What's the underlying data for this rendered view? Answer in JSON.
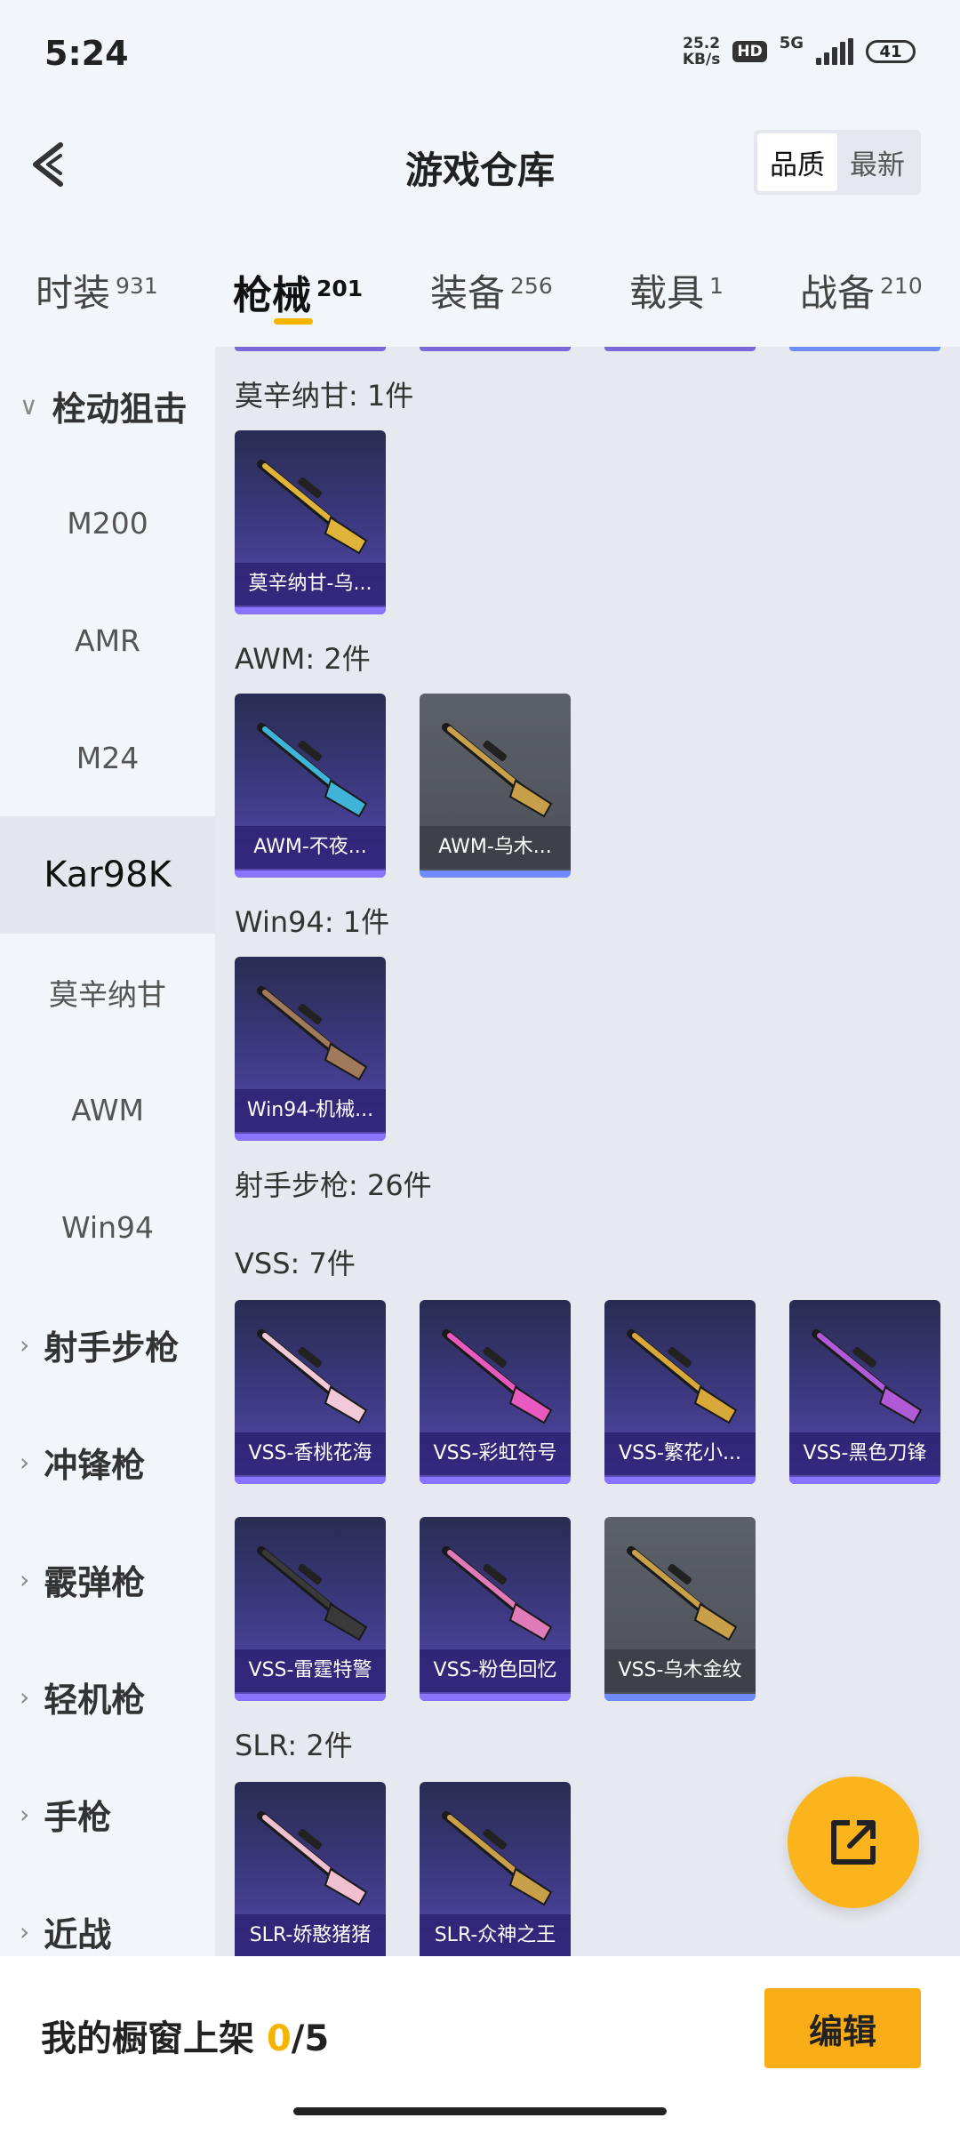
{
  "status_bar": {
    "time": "5:24",
    "net_speed_value": "25.2",
    "net_speed_unit": "KB/s",
    "hd_badge": "HD",
    "network": "5G",
    "battery": "41"
  },
  "header": {
    "title": "游戏仓库",
    "sort_options": [
      "品质",
      "最新"
    ],
    "active_sort": "品质"
  },
  "tabs": [
    {
      "label": "时装",
      "count": "931"
    },
    {
      "label": "枪械",
      "count": "201",
      "active": true
    },
    {
      "label": "装备",
      "count": "256"
    },
    {
      "label": "载具",
      "count": "1"
    },
    {
      "label": "战备",
      "count": "210"
    }
  ],
  "sidebar": {
    "items": [
      {
        "label": "栓动狙击",
        "type": "group",
        "expanded": true
      },
      {
        "label": "M200",
        "type": "sub"
      },
      {
        "label": "AMR",
        "type": "sub"
      },
      {
        "label": "M24",
        "type": "sub"
      },
      {
        "label": "Kar98K",
        "type": "sub",
        "selected": true
      },
      {
        "label": "莫辛纳甘",
        "type": "sub"
      },
      {
        "label": "AWM",
        "type": "sub"
      },
      {
        "label": "Win94",
        "type": "sub"
      },
      {
        "label": "射手步枪",
        "type": "group"
      },
      {
        "label": "冲锋枪",
        "type": "group"
      },
      {
        "label": "霰弹枪",
        "type": "group"
      },
      {
        "label": "轻机枪",
        "type": "group"
      },
      {
        "label": "手枪",
        "type": "group"
      },
      {
        "label": "近战",
        "type": "group"
      }
    ]
  },
  "sections": {
    "mosin": {
      "title": "莫辛纳甘: 1件",
      "items": [
        {
          "label": "莫辛纳甘-乌...",
          "style": "purple",
          "gun_color": "#e0b43a"
        }
      ]
    },
    "awm": {
      "title": "AWM: 2件",
      "items": [
        {
          "label": "AWM-不夜...",
          "style": "purple",
          "gun_color": "#3fb4d8"
        },
        {
          "label": "AWM-乌木...",
          "style": "gray",
          "gun_color": "#c9a04a"
        }
      ]
    },
    "win94": {
      "title": "Win94: 1件",
      "items": [
        {
          "label": "Win94-机械...",
          "style": "purple",
          "gun_color": "#a07a5a"
        }
      ]
    },
    "marksman": {
      "title": "射手步枪: 26件"
    },
    "vss": {
      "title": "VSS: 7件",
      "items": [
        {
          "label": "VSS-香桃花海",
          "style": "purple",
          "gun_color": "#f2c9d8"
        },
        {
          "label": "VSS-彩虹符号",
          "style": "purple",
          "gun_color": "#e85ac0"
        },
        {
          "label": "VSS-繁花小...",
          "style": "purple",
          "gun_color": "#d9a83a"
        },
        {
          "label": "VSS-黑色刀锋",
          "style": "purple",
          "gun_color": "#b05ad8"
        },
        {
          "label": "VSS-雷霆特警",
          "style": "purple",
          "gun_color": "#3a3a3a"
        },
        {
          "label": "VSS-粉色回忆",
          "style": "purple",
          "gun_color": "#e07ab8"
        },
        {
          "label": "VSS-乌木金纹",
          "style": "gray",
          "gun_color": "#c9a04a"
        }
      ]
    },
    "slr": {
      "title": "SLR: 2件",
      "items": [
        {
          "label": "SLR-娇憨猪猪",
          "style": "purple",
          "gun_color": "#f0c0d0"
        },
        {
          "label": "SLR-众神之王",
          "style": "purple",
          "gun_color": "#c9a04a"
        }
      ]
    }
  },
  "bottom_bar": {
    "label": "我的橱窗上架 ",
    "current": "0",
    "total": "/5",
    "edit_label": "编辑"
  },
  "colors": {
    "accent": "#f5b400",
    "fab": "#fbb41c",
    "card_purple": "#3e3a84",
    "card_gray": "#55585f"
  }
}
